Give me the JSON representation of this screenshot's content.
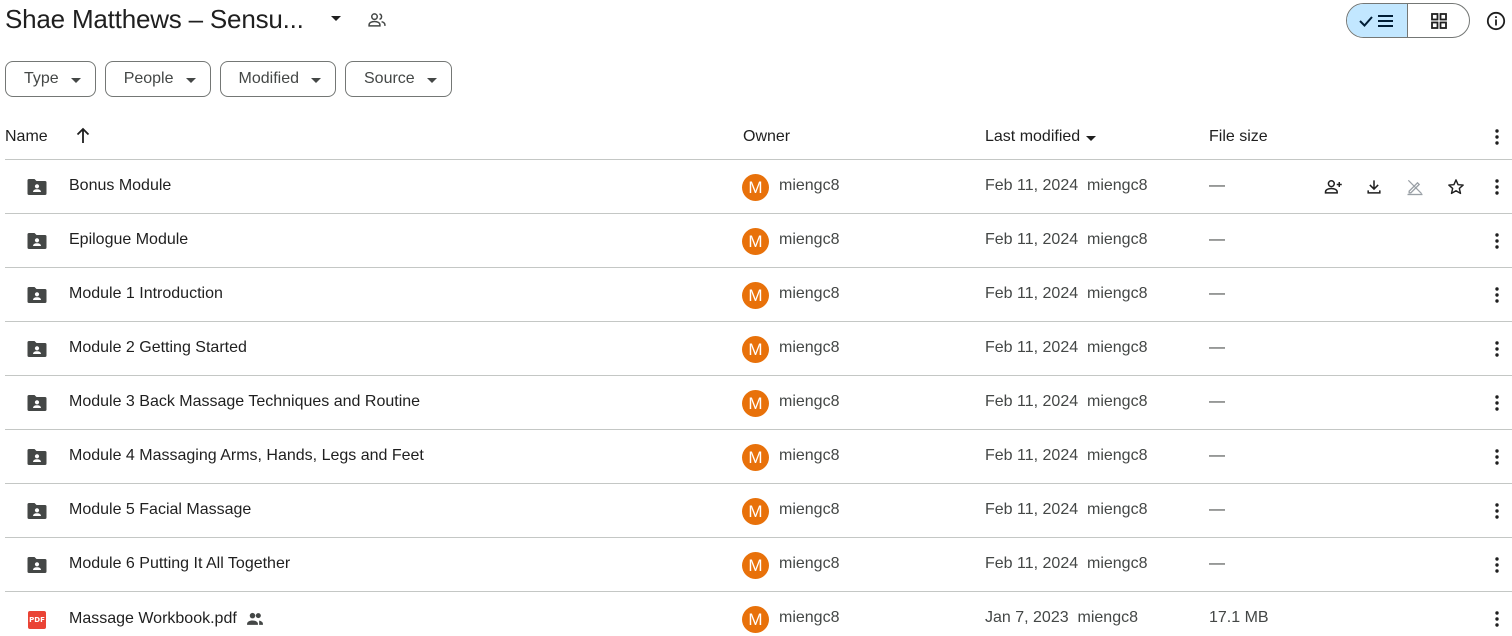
{
  "header": {
    "title": "Shae Matthews – Sensu...",
    "accent_selected": "#c2e7ff"
  },
  "filters": [
    {
      "label": "Type"
    },
    {
      "label": "People"
    },
    {
      "label": "Modified"
    },
    {
      "label": "Source"
    }
  ],
  "columns": {
    "name": "Name",
    "owner": "Owner",
    "last_modified": "Last modified",
    "file_size": "File size"
  },
  "rows": [
    {
      "type": "shared-folder",
      "name": "Bonus Module",
      "owner_initial": "M",
      "owner": "miengc8",
      "modified": "Feb 11, 2024",
      "modified_by": "miengc8",
      "size": "—",
      "hovered": true
    },
    {
      "type": "shared-folder",
      "name": "Epilogue Module",
      "owner_initial": "M",
      "owner": "miengc8",
      "modified": "Feb 11, 2024",
      "modified_by": "miengc8",
      "size": "—"
    },
    {
      "type": "shared-folder",
      "name": "Module 1 Introduction",
      "owner_initial": "M",
      "owner": "miengc8",
      "modified": "Feb 11, 2024",
      "modified_by": "miengc8",
      "size": "—"
    },
    {
      "type": "shared-folder",
      "name": "Module 2 Getting Started",
      "owner_initial": "M",
      "owner": "miengc8",
      "modified": "Feb 11, 2024",
      "modified_by": "miengc8",
      "size": "—"
    },
    {
      "type": "shared-folder",
      "name": "Module 3 Back Massage Techniques and Routine",
      "owner_initial": "M",
      "owner": "miengc8",
      "modified": "Feb 11, 2024",
      "modified_by": "miengc8",
      "size": "—"
    },
    {
      "type": "shared-folder",
      "name": "Module 4 Massaging Arms, Hands, Legs and Feet",
      "owner_initial": "M",
      "owner": "miengc8",
      "modified": "Feb 11, 2024",
      "modified_by": "miengc8",
      "size": "—"
    },
    {
      "type": "shared-folder",
      "name": "Module 5 Facial Massage",
      "owner_initial": "M",
      "owner": "miengc8",
      "modified": "Feb 11, 2024",
      "modified_by": "miengc8",
      "size": "—"
    },
    {
      "type": "shared-folder",
      "name": "Module 6 Putting It All Together",
      "owner_initial": "M",
      "owner": "miengc8",
      "modified": "Feb 11, 2024",
      "modified_by": "miengc8",
      "size": "—"
    },
    {
      "type": "pdf",
      "name": "Massage Workbook.pdf",
      "icon_label": "PDF",
      "shared": true,
      "owner_initial": "M",
      "owner": "miengc8",
      "modified": "Jan 7, 2023",
      "modified_by": "miengc8",
      "size": "17.1 MB"
    }
  ],
  "avatar_color": "#e8710a"
}
